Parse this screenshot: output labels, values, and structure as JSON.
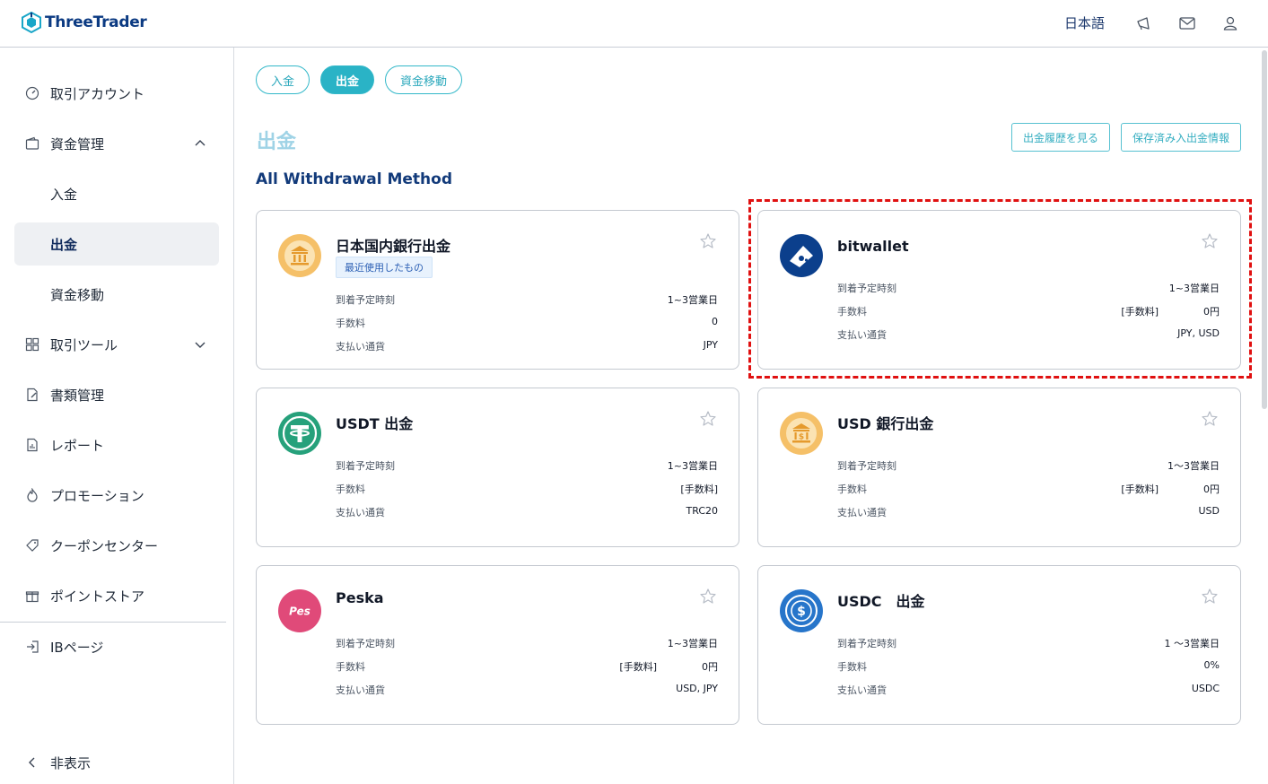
{
  "header": {
    "brand": "ThreeTrader",
    "language": "日本語",
    "icons": [
      "megaphone-icon",
      "mail-icon",
      "user-icon"
    ]
  },
  "sidebar": {
    "items": [
      {
        "label": "取引アカウント",
        "icon": "speedometer-icon"
      },
      {
        "label": "資金管理",
        "icon": "wallet-icon",
        "expanded": true
      },
      {
        "label": "入金"
      },
      {
        "label": "出金",
        "active": true
      },
      {
        "label": "資金移動"
      },
      {
        "label": "取引ツール",
        "icon": "grid-icon",
        "expanded": false
      },
      {
        "label": "書類管理",
        "icon": "document-edit-icon"
      },
      {
        "label": "レポート",
        "icon": "report-icon"
      },
      {
        "label": "プロモーション",
        "icon": "fire-icon"
      },
      {
        "label": "クーポンセンター",
        "icon": "ticket-icon"
      },
      {
        "label": "ポイントストア",
        "icon": "gift-icon"
      },
      {
        "label": "IBページ",
        "icon": "login-icon"
      }
    ],
    "hide_label": "非表示"
  },
  "tabs": [
    {
      "label": "入金",
      "active": false
    },
    {
      "label": "出金",
      "active": true
    },
    {
      "label": "資金移動",
      "active": false
    }
  ],
  "page": {
    "title": "出金",
    "history_button": "出金履歴を見る",
    "saved_button": "保存済み入出金情報",
    "section_title": "All Withdrawal Method"
  },
  "labels": {
    "arrival": "到着予定時刻",
    "fee": "手数料",
    "currency": "支払い通貨"
  },
  "methods": [
    {
      "title": "日本国内銀行出金",
      "badge": "最近使用したもの",
      "arrival": "1~3営業日",
      "fee_tag": "",
      "fee": "0",
      "currency": "JPY",
      "icon": "bank-icon"
    },
    {
      "title": "bitwallet",
      "badge": "",
      "arrival": "1~3営業日",
      "fee_tag": "[手数料]",
      "fee": "0円",
      "currency": "JPY, USD",
      "icon": "bitwallet-icon"
    },
    {
      "title": "USDT 出金",
      "badge": "",
      "arrival": "1~3営業日",
      "fee_tag": "",
      "fee": "[手数料]",
      "currency": "TRC20",
      "icon": "tether-icon"
    },
    {
      "title": "USD 銀行出金",
      "badge": "",
      "arrival": "1〜3営業日",
      "fee_tag": "[手数料]",
      "fee": "0円",
      "currency": "USD",
      "icon": "usd-bank-icon"
    },
    {
      "title": "Peska",
      "badge": "",
      "arrival": "1~3営業日",
      "fee_tag": "[手数料]",
      "fee": "0円",
      "currency": "USD, JPY",
      "icon": "peska-icon"
    },
    {
      "title": "USDC　出金",
      "badge": "",
      "arrival": "1 〜3営業日",
      "fee_tag": "",
      "fee": "0%",
      "currency": "USDC",
      "icon": "usdc-icon"
    }
  ],
  "colors": {
    "accent": "#2ab3c6",
    "navy": "#123a7a",
    "highlight": "#e01010"
  }
}
